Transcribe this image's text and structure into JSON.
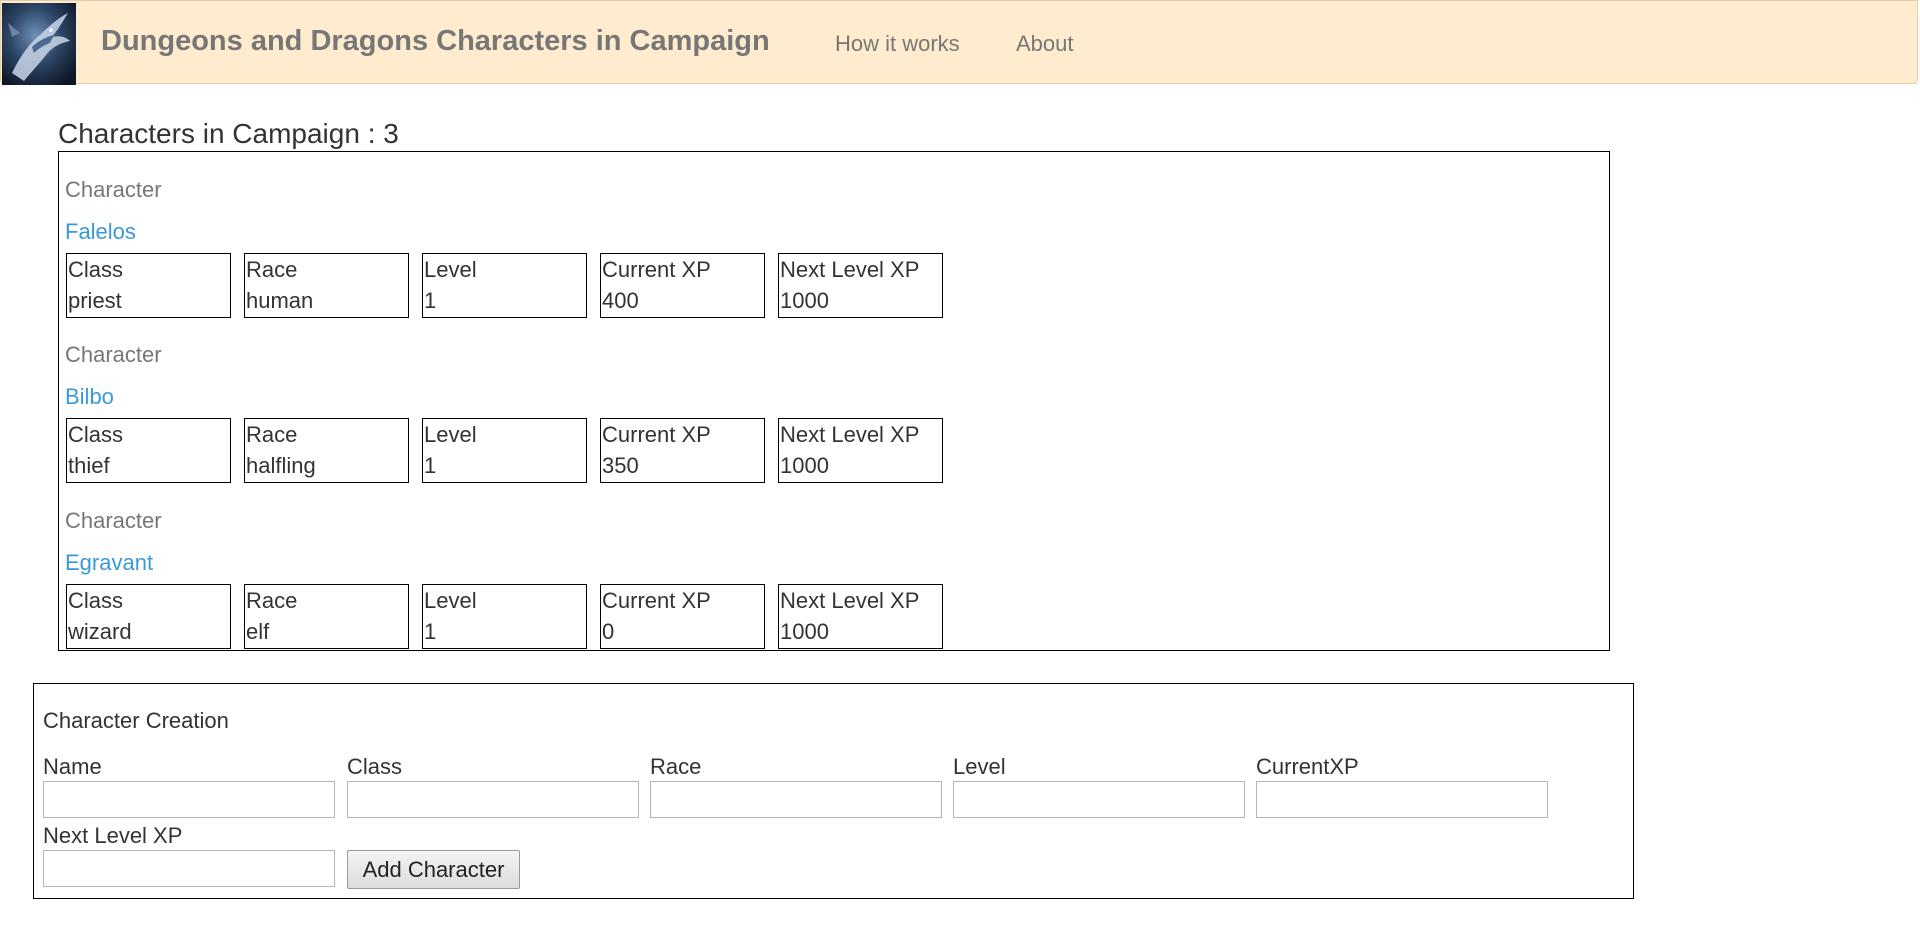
{
  "navbar": {
    "brand": "Dungeons and Dragons Characters in Campaign",
    "links": [
      "How it works",
      "About"
    ]
  },
  "campaign": {
    "heading": "Characters in Campaign : 3",
    "character_tag": "Character",
    "stat_labels": [
      "Class",
      "Race",
      "Level",
      "Current XP",
      "Next Level XP"
    ],
    "characters": [
      {
        "name": "Falelos",
        "class": "priest",
        "race": "human",
        "level": "1",
        "current_xp": "400",
        "next_level_xp": "1000"
      },
      {
        "name": "Bilbo",
        "class": "thief",
        "race": "halfling",
        "level": "1",
        "current_xp": "350",
        "next_level_xp": "1000"
      },
      {
        "name": "Egravant",
        "class": "wizard",
        "race": "elf",
        "level": "1",
        "current_xp": "0",
        "next_level_xp": "1000"
      }
    ]
  },
  "creation": {
    "title": "Character Creation",
    "labels": {
      "name": "Name",
      "class": "Class",
      "race": "Race",
      "level": "Level",
      "current_xp": "CurrentXP",
      "next_level_xp": "Next Level XP"
    },
    "values": {
      "name": "",
      "class": "",
      "race": "",
      "level": "",
      "current_xp": "",
      "next_level_xp": ""
    },
    "add_button": "Add Character"
  },
  "colors": {
    "navbar_bg": "#ffebcd",
    "link_blue": "#3a9ad9",
    "muted_text": "#777777"
  }
}
